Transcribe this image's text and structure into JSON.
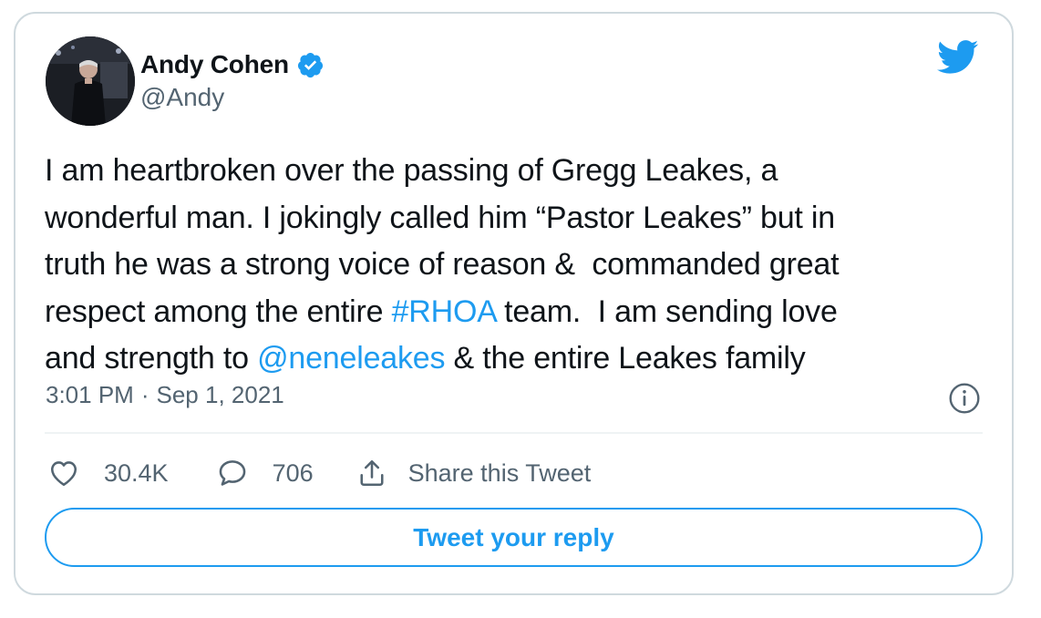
{
  "author": {
    "name": "Andy Cohen",
    "handle": "@Andy",
    "avatar_icon": "avatar-photo-icon",
    "verified_icon": "verified-badge-icon"
  },
  "brand": {
    "icon": "twitter-bird-icon",
    "accent_color": "#1d9bf0"
  },
  "tweet": {
    "segments": [
      {
        "text": "I am heartbroken over the passing of Gregg Leakes, a\nwonderful man. I jokingly called him “Pastor Leakes” but in\ntruth he was a strong voice of reason &  commanded great\nrespect among the entire ",
        "link": false
      },
      {
        "text": "#RHOA",
        "link": true
      },
      {
        "text": " team.  I am sending love\nand strength to ",
        "link": false
      },
      {
        "text": "@neneleakes",
        "link": true
      },
      {
        "text": " & the entire Leakes family",
        "link": false
      }
    ]
  },
  "meta": {
    "time": "3:01 PM",
    "separator": "·",
    "date": "Sep 1, 2021",
    "info_icon": "info-icon"
  },
  "actions": {
    "like_count": "30.4K",
    "reply_count": "706",
    "share_label": "Share this Tweet"
  },
  "reply_button": {
    "label": "Tweet your reply"
  }
}
